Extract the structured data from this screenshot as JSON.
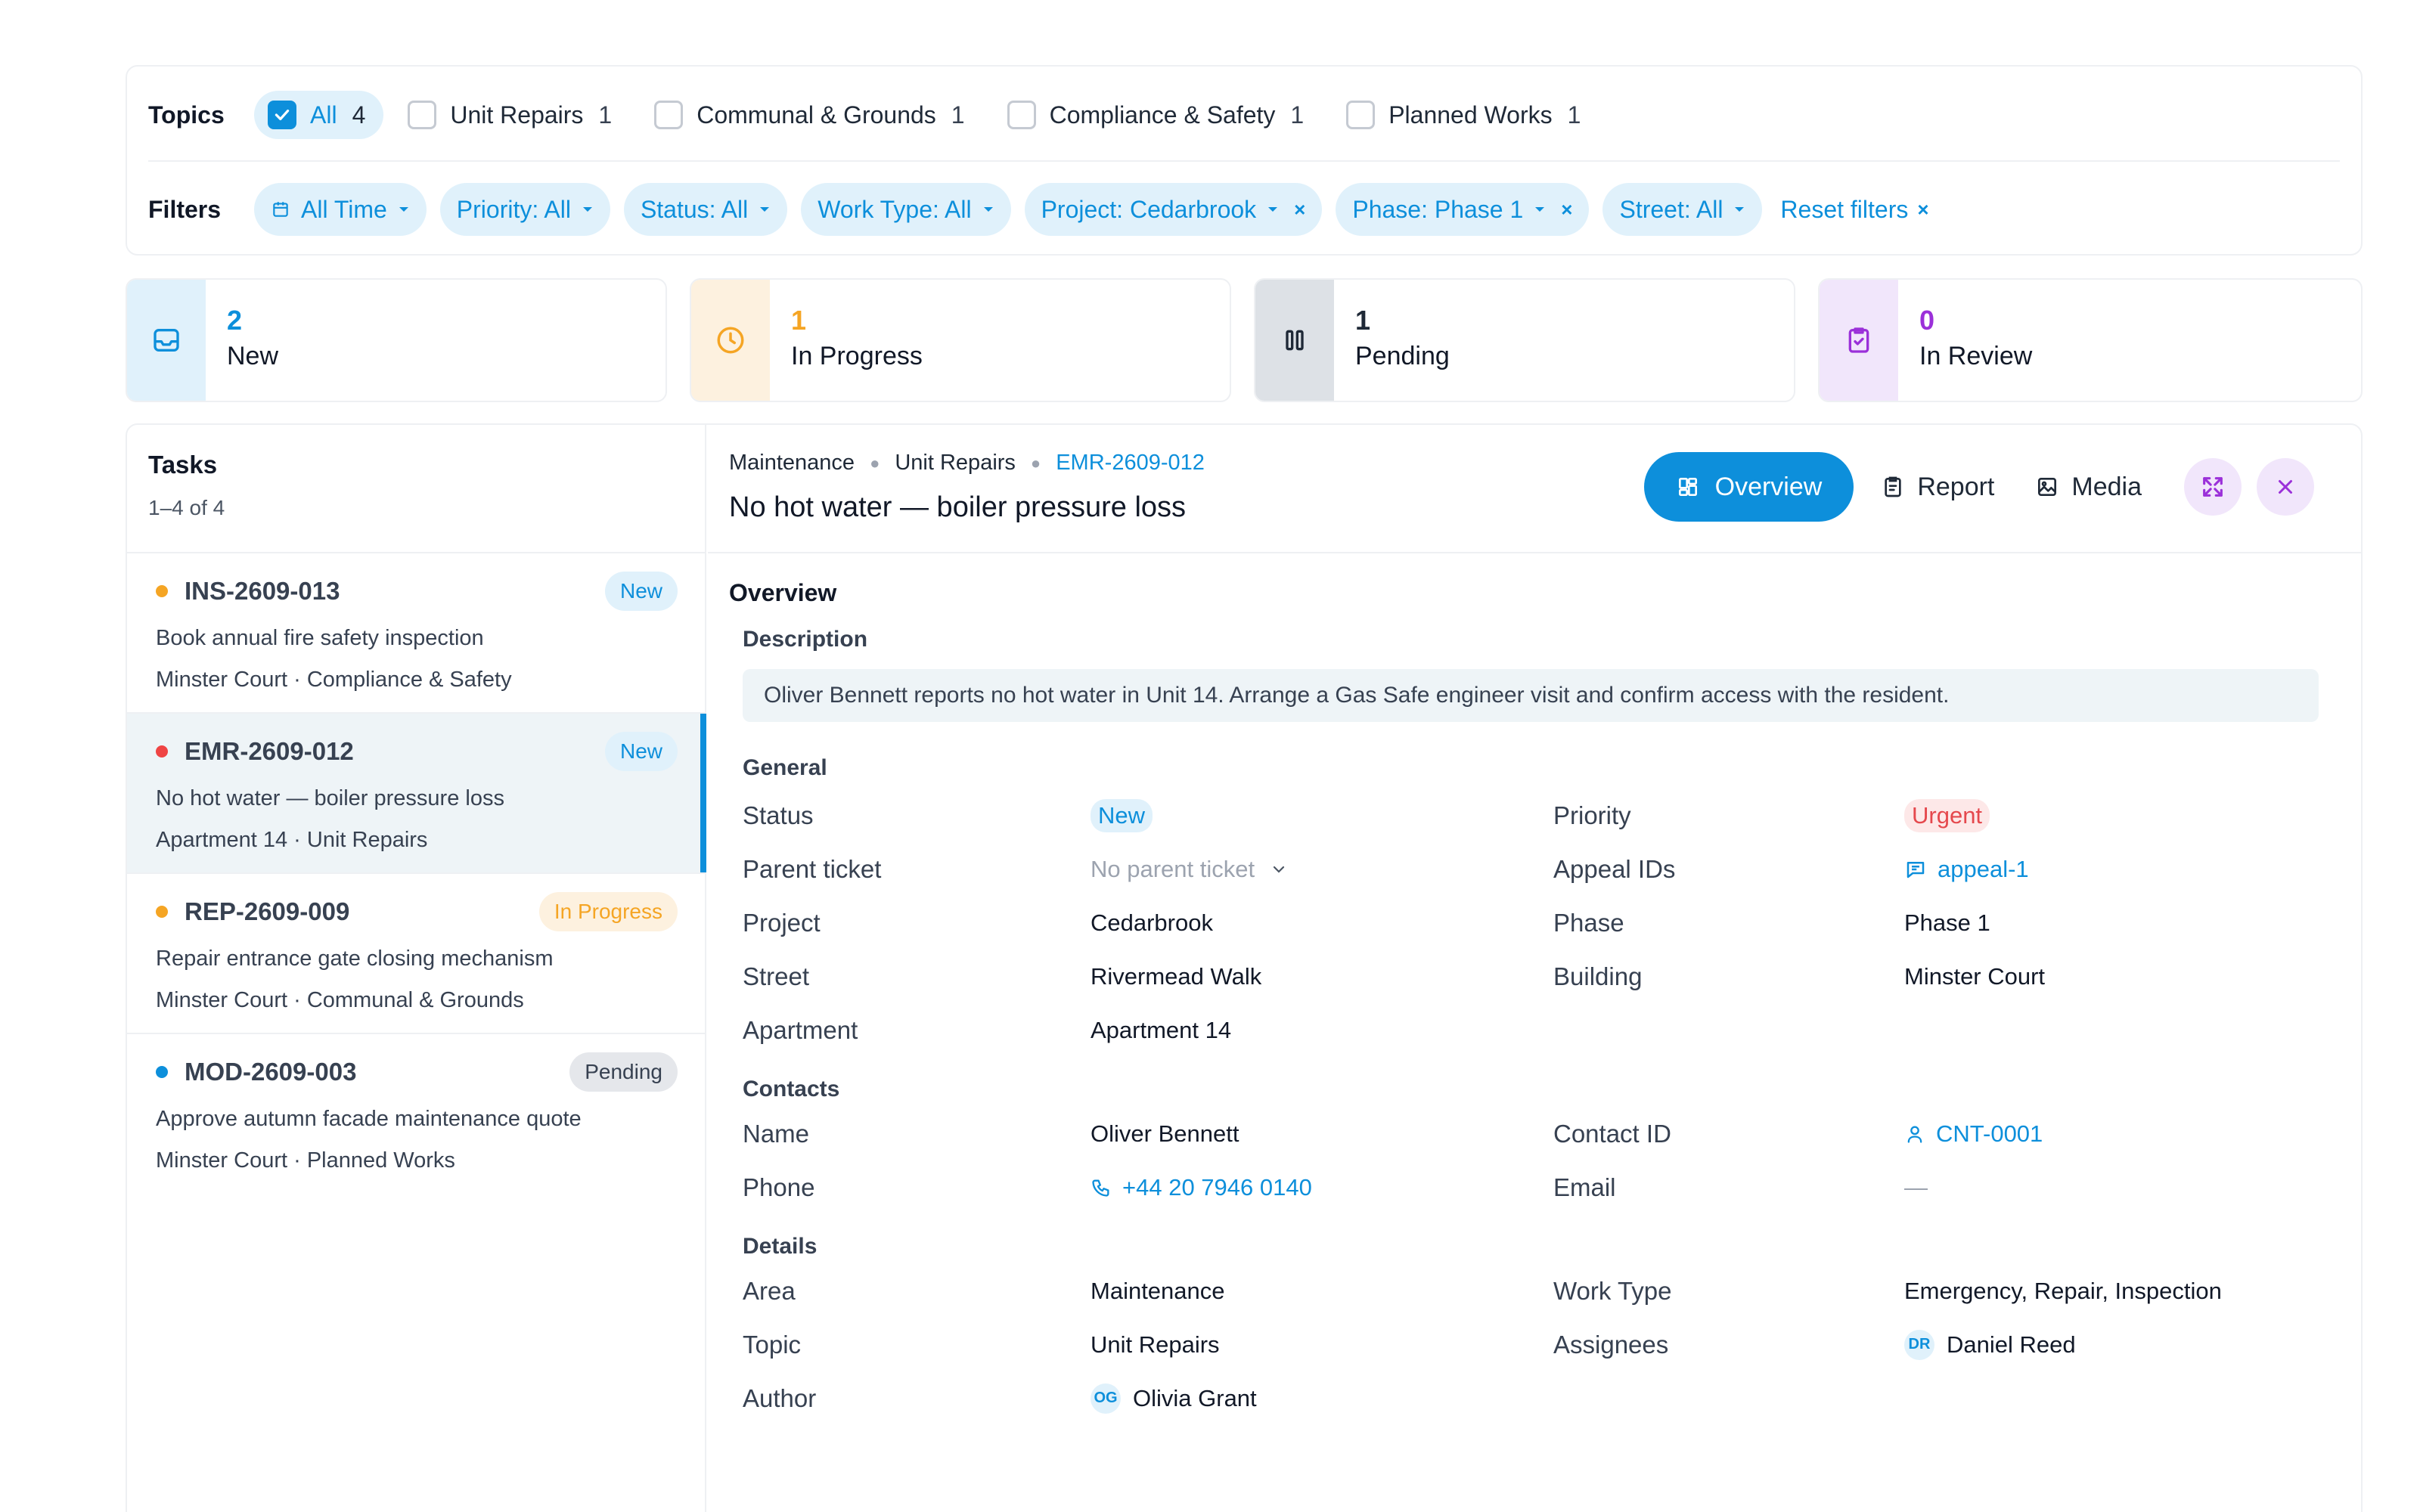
{
  "topics": {
    "label": "Topics",
    "items": [
      {
        "label": "All",
        "count": "4",
        "checked": true
      },
      {
        "label": "Unit Repairs",
        "count": "1",
        "checked": false
      },
      {
        "label": "Communal & Grounds",
        "count": "1",
        "checked": false
      },
      {
        "label": "Compliance & Safety",
        "count": "1",
        "checked": false
      },
      {
        "label": "Planned Works",
        "count": "1",
        "checked": false
      }
    ]
  },
  "filters": {
    "label": "Filters",
    "items": [
      {
        "label": "All Time",
        "icon": "calendar-icon"
      },
      {
        "label": "Priority: All"
      },
      {
        "label": "Status: All"
      },
      {
        "label": "Work Type: All"
      },
      {
        "label": "Project: Cedarbrook",
        "clearable": true
      },
      {
        "label": "Phase: Phase 1",
        "clearable": true
      },
      {
        "label": "Street: All"
      }
    ],
    "reset": "Reset filters",
    "clear_glyph": "×"
  },
  "status_cards": [
    {
      "count": "2",
      "label": "New",
      "color": "#0d8fdb",
      "bg": "#e0f1fb",
      "icon": "inbox-icon"
    },
    {
      "count": "1",
      "label": "In Progress",
      "color": "#f5a524",
      "bg": "#fdf1df",
      "icon": "clock-icon"
    },
    {
      "count": "1",
      "label": "Pending",
      "color": "#1f2937",
      "bg": "#dde1e6",
      "icon": "pause-icon"
    },
    {
      "count": "0",
      "label": "In Review",
      "color": "#9b30d9",
      "bg": "#f1e6fb",
      "icon": "clipboard-check-icon"
    }
  ],
  "tasks": {
    "title": "Tasks",
    "range": "1–4 of 4",
    "items": [
      {
        "id": "INS-2609-013",
        "badge": "New",
        "badge_color": "#0d8fdb",
        "badge_bg": "#e0f1fb",
        "dot": "#f5a524",
        "desc": "Book annual fire safety inspection",
        "meta": "Minster Court · Compliance & Safety",
        "selected": false
      },
      {
        "id": "EMR-2609-012",
        "badge": "New",
        "badge_color": "#0d8fdb",
        "badge_bg": "#e0f1fb",
        "dot": "#ef4444",
        "desc": "No hot water — boiler pressure loss",
        "meta": "Apartment 14 · Unit Repairs",
        "selected": true
      },
      {
        "id": "REP-2609-009",
        "badge": "In Progress",
        "badge_color": "#f5a524",
        "badge_bg": "#fdf1df",
        "dot": "#f5a524",
        "desc": "Repair entrance gate closing mechanism",
        "meta": "Minster Court · Communal & Grounds",
        "selected": false
      },
      {
        "id": "MOD-2609-003",
        "badge": "Pending",
        "badge_color": "#374151",
        "badge_bg": "#e5e7eb",
        "dot": "#0d8fdb",
        "desc": "Approve autumn facade maintenance quote",
        "meta": "Minster Court · Planned Works",
        "selected": false
      }
    ]
  },
  "detail": {
    "breadcrumb": [
      "Maintenance",
      "Unit Repairs",
      "EMR-2609-012"
    ],
    "title": "No hot water — boiler pressure loss",
    "actions": {
      "overview": "Overview",
      "report": "Report",
      "media": "Media"
    },
    "overview_title": "Overview",
    "description_title": "Description",
    "description": "Oliver Bennett reports no hot water in Unit 14. Arrange a Gas Safe engineer visit and confirm access with the resident.",
    "general_title": "General",
    "general": {
      "status_label": "Status",
      "status": "New",
      "priority_label": "Priority",
      "priority": "Urgent",
      "parent_label": "Parent ticket",
      "parent": "No parent ticket",
      "appeal_label": "Appeal IDs",
      "appeal": "appeal-1",
      "project_label": "Project",
      "project": "Cedarbrook",
      "phase_label": "Phase",
      "phase": "Phase 1",
      "street_label": "Street",
      "street": "Rivermead Walk",
      "building_label": "Building",
      "building": "Minster Court",
      "apartment_label": "Apartment",
      "apartment": "Apartment 14"
    },
    "contacts_title": "Contacts",
    "contacts": {
      "name_label": "Name",
      "name": "Oliver Bennett",
      "contact_id_label": "Contact ID",
      "contact_id": "CNT-0001",
      "phone_label": "Phone",
      "phone": "+44 20 7946 0140",
      "email_label": "Email",
      "email": "—"
    },
    "details_title": "Details",
    "details": {
      "area_label": "Area",
      "area": "Maintenance",
      "work_type_label": "Work Type",
      "work_type": "Emergency, Repair, Inspection",
      "topic_label": "Topic",
      "topic": "Unit Repairs",
      "assignees_label": "Assignees",
      "assignee_initials": "DR",
      "assignee": "Daniel Reed",
      "author_label": "Author",
      "author_initials": "OG",
      "author": "Olivia Grant"
    }
  }
}
